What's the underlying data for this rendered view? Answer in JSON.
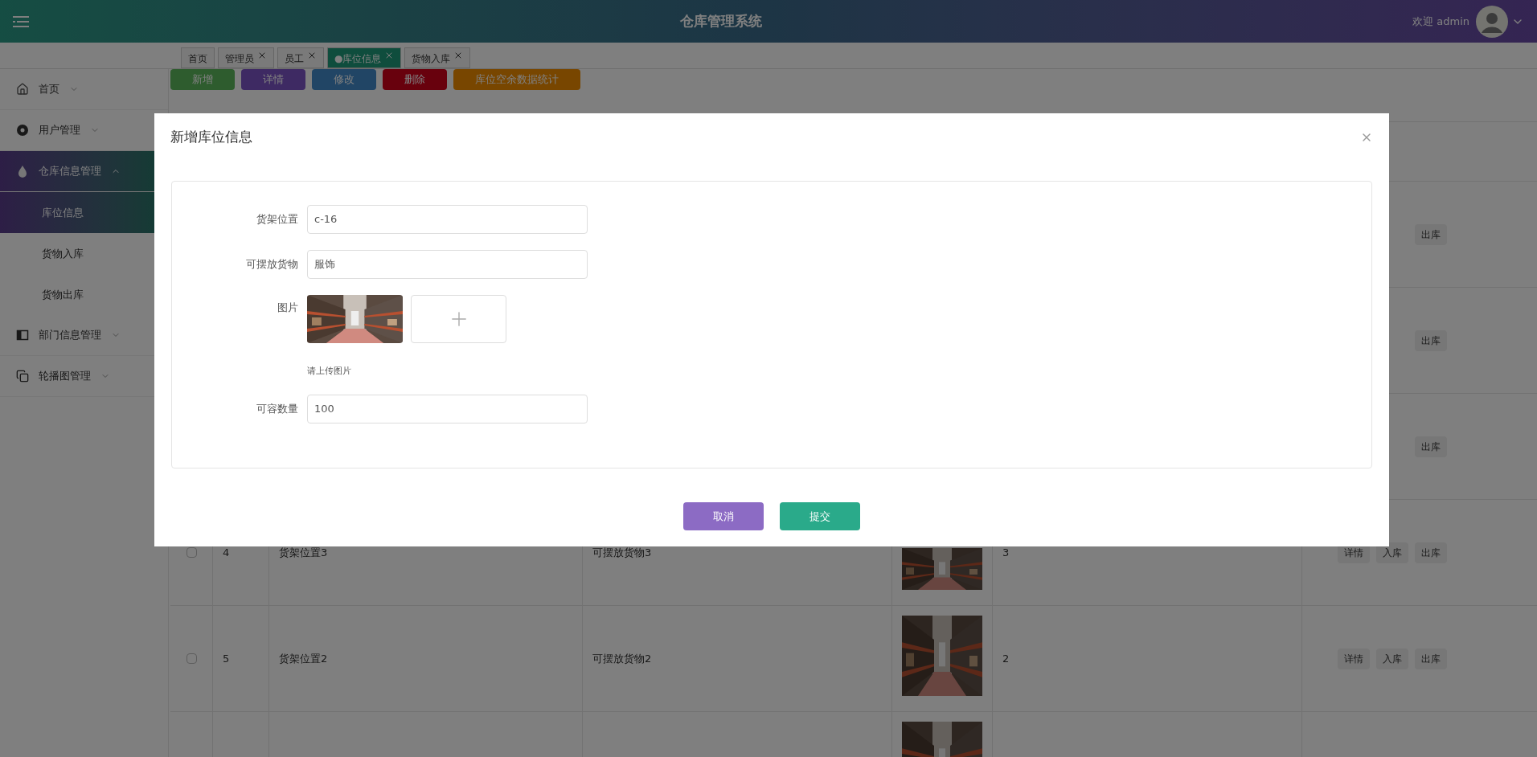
{
  "header": {
    "title": "仓库管理系统",
    "welcome": "欢迎 admin"
  },
  "tabs": [
    {
      "label": "首页",
      "closable": false,
      "selected": false
    },
    {
      "label": "管理员",
      "closable": true,
      "selected": false
    },
    {
      "label": "员工",
      "closable": true,
      "selected": false
    },
    {
      "label": "●库位信息",
      "closable": true,
      "selected": true
    },
    {
      "label": "货物入库",
      "closable": true,
      "selected": false
    }
  ],
  "sidebar": {
    "items": [
      {
        "label": "首页",
        "expanded": false
      },
      {
        "label": "用户管理",
        "expanded": false
      },
      {
        "label": "仓库信息管理",
        "expanded": true,
        "children": [
          {
            "label": "库位信息",
            "selected": true
          },
          {
            "label": "货物入库",
            "selected": false
          },
          {
            "label": "货物出库",
            "selected": false
          }
        ]
      },
      {
        "label": "部门信息管理",
        "expanded": false
      },
      {
        "label": "轮播图管理",
        "expanded": false
      }
    ]
  },
  "toolbar": [
    "新增",
    "详情",
    "修改",
    "删除",
    "库位空余数据统计"
  ],
  "table": {
    "rows": [
      {
        "actions": [
          "出库"
        ]
      },
      {
        "actions": [
          "出库"
        ]
      },
      {
        "actions": [
          "出库"
        ]
      },
      {
        "index": "4",
        "location": "货架位置3",
        "goods": "可摆放货物3",
        "picture": true,
        "count": "3",
        "checked": false,
        "actions": [
          "详情",
          "入库",
          "出库"
        ]
      },
      {
        "index": "5",
        "location": "货架位置2",
        "goods": "可摆放货物2",
        "picture": true,
        "count": "2",
        "checked": false,
        "actions": [
          "详情",
          "入库",
          "出库"
        ]
      },
      {
        "picture": true
      }
    ]
  },
  "dialog": {
    "title": "新增库位信息",
    "fields": [
      {
        "kind": "text",
        "label": "货架位置",
        "value": "c-16"
      },
      {
        "kind": "text",
        "label": "可摆放货物",
        "value": "服饰"
      },
      {
        "label": "图片",
        "hint": "请上传图片"
      },
      {
        "kind": "text",
        "label": "可容数量",
        "value": "100"
      }
    ],
    "buttons": [
      {
        "label": "取消",
        "kind": "cancel"
      },
      {
        "label": "提交",
        "kind": "submit"
      }
    ]
  }
}
